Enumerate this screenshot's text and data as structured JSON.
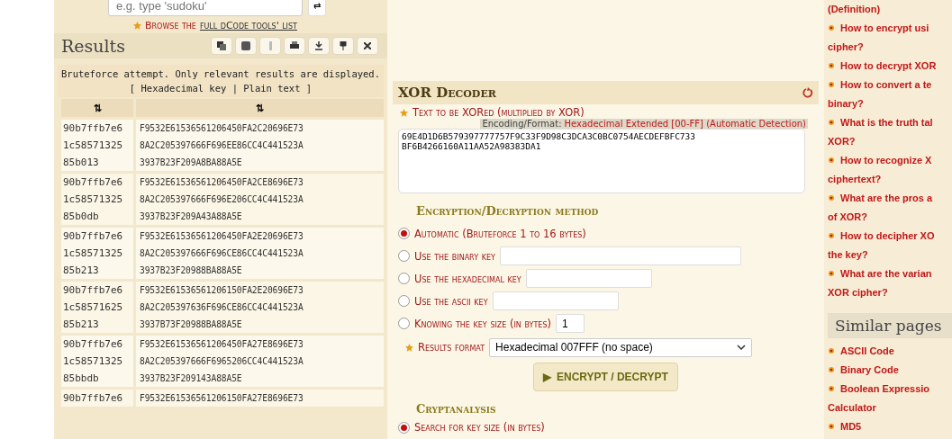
{
  "search": {
    "placeholder": "e.g. type 'sudoku'",
    "button": "⇄"
  },
  "browse": {
    "prefix": "Browse the",
    "link": "full dCode tools' list"
  },
  "results": {
    "title": "Results",
    "note": "Bruteforce attempt. Only relevant results are displayed.",
    "legend": "[ Hexadecimal key | Plain text ]",
    "sort_columns": [
      "⇅",
      "⇅"
    ],
    "rows": [
      {
        "key": [
          "90b7ffb7e6",
          "1c58571325",
          "85b013"
        ],
        "text": [
          "F9532E61536561206450FA2C20696E73",
          "8A2C205397666F696EE86CC4C441523A",
          "3937B23F209A8BA88A5E"
        ]
      },
      {
        "key": [
          "90b7ffb7e6",
          "1c58571325",
          "85b0db"
        ],
        "text": [
          "F9532E61536561206450FA2CE8696E73",
          "8A2C205397666F696E206CC4C441523A",
          "3937B23F209A43A88A5E"
        ]
      },
      {
        "key": [
          "90b7ffb7e6",
          "1c58571325",
          "85b213"
        ],
        "text": [
          "F9532E61536561206450FA2E20696E73",
          "8A2C205397666F696CE86CC4C441523A",
          "3937B23F20988BA88A5E"
        ]
      },
      {
        "key": [
          "90b7ffb7e6",
          "1c58571625",
          "85b213"
        ],
        "text": [
          "F9532E61536561206150FA2E20696E73",
          "8A2C205397636F696CE86CC4C441523A",
          "3937B73F20988BA88A5E"
        ]
      },
      {
        "key": [
          "90b7ffb7e6",
          "1c58571325",
          "85bbdb"
        ],
        "text": [
          "F9532E61536561206450FA27E8696E73",
          "8A2C205397666F6965206CC4C441523A",
          "3937B23F209143A88A5E"
        ]
      },
      {
        "key": [
          "90b7ffb7e6"
        ],
        "text": [
          "F9532E61536561206150FA27E8696E73"
        ]
      }
    ]
  },
  "decoder": {
    "title": "XOR Decoder",
    "input_label": "Text to be XORed (multiplied by XOR)",
    "encoding_label": "Encoding/Format:",
    "encoding_value": "Hexadecimal Extended [00-FF] (Automatic Detection)",
    "input_value": "69E4D1D6B579397777757F9C33F9D98C3DCA3C0BC0754AECDEFBFC733\nBF6B4266160A11AA52A98383DA1",
    "method_title": "Encryption/Decryption method",
    "options": [
      {
        "label": "Automatic (Bruteforce 1 to 16 bytes)",
        "selected": true,
        "kind": "plain"
      },
      {
        "label": "Use the binary key",
        "selected": false,
        "kind": "wide"
      },
      {
        "label": "Use the hexadecimal key",
        "selected": false,
        "kind": "medium"
      },
      {
        "label": "Use the ascii key",
        "selected": false,
        "kind": "medium"
      },
      {
        "label": "Knowing the key size (in bytes)",
        "selected": false,
        "kind": "small",
        "value": "1"
      }
    ],
    "format_label": "Results format",
    "format_value": "Hexadecimal 007FFF (no space)",
    "submit_icon": "▶",
    "submit": "ENCRYPT / DECRYPT",
    "crypt_title": "Cryptanalysis",
    "crypt_options": [
      {
        "label": "Search for key size (in bytes)",
        "selected": true
      }
    ]
  },
  "faq": {
    "lead": "(Definition)",
    "items": [
      [
        "How to encrypt usi",
        "cipher?"
      ],
      [
        "How to decrypt XOR"
      ],
      [
        "How to convert a te",
        "binary?"
      ],
      [
        "What is the truth tal",
        "XOR?"
      ],
      [
        "How to recognize X",
        "ciphertext?"
      ],
      [
        "What are the pros a",
        "of XOR?"
      ],
      [
        "How to decipher XO",
        "the key?"
      ],
      [
        "What are the varian",
        "XOR cipher?"
      ]
    ]
  },
  "similar": {
    "title": "Similar pages",
    "items": [
      [
        "ASCII Code"
      ],
      [
        "Binary Code"
      ],
      [
        "Boolean Expressio",
        "Calculator"
      ],
      [
        "MD5"
      ]
    ]
  }
}
